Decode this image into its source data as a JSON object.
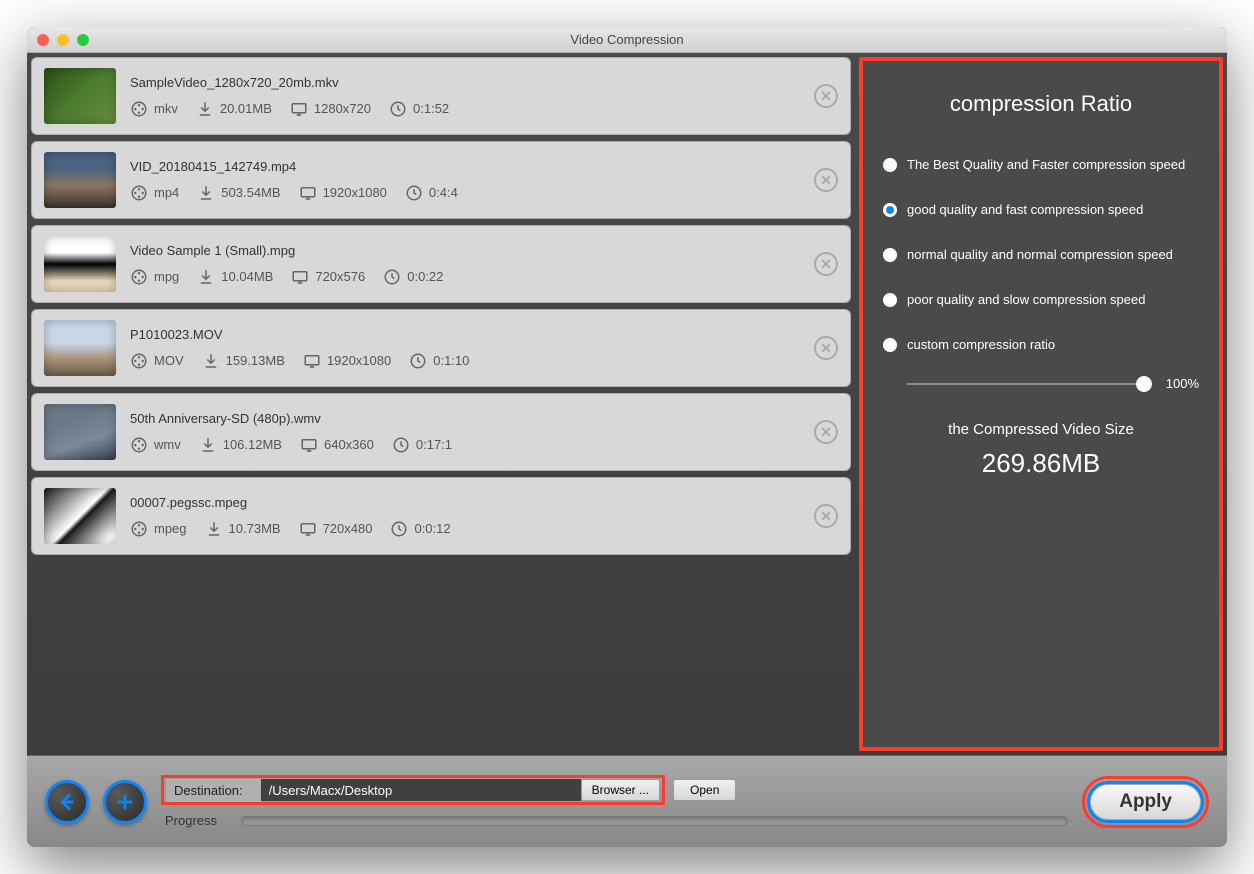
{
  "window": {
    "title": "Video Compression"
  },
  "files": [
    {
      "name": "SampleVideo_1280x720_20mb.mkv",
      "format": "mkv",
      "size": "20.01MB",
      "resolution": "1280x720",
      "duration": "0:1:52"
    },
    {
      "name": "VID_20180415_142749.mp4",
      "format": "mp4",
      "size": "503.54MB",
      "resolution": "1920x1080",
      "duration": "0:4:4"
    },
    {
      "name": "Video Sample 1 (Small).mpg",
      "format": "mpg",
      "size": "10.04MB",
      "resolution": "720x576",
      "duration": "0:0:22"
    },
    {
      "name": "P1010023.MOV",
      "format": "MOV",
      "size": "159.13MB",
      "resolution": "1920x1080",
      "duration": "0:1:10"
    },
    {
      "name": "50th Anniversary-SD (480p).wmv",
      "format": "wmv",
      "size": "106.12MB",
      "resolution": "640x360",
      "duration": "0:17:1"
    },
    {
      "name": "00007.pegssc.mpeg",
      "format": "mpeg",
      "size": "10.73MB",
      "resolution": "720x480",
      "duration": "0:0:12"
    }
  ],
  "sidebar": {
    "title": "compression Ratio",
    "options": [
      {
        "label": "The Best Quality and Faster compression speed",
        "checked": false
      },
      {
        "label": "good quality and fast compression speed",
        "checked": true
      },
      {
        "label": "normal quality and normal compression speed",
        "checked": false
      },
      {
        "label": "poor quality and slow compression speed",
        "checked": false
      },
      {
        "label": "custom compression ratio",
        "checked": false
      }
    ],
    "slider_value": "100%",
    "size_label": "the Compressed Video Size",
    "size_value": "269.86MB"
  },
  "footer": {
    "destination_label": "Destination:",
    "destination_value": "/Users/Macx/Desktop",
    "browser_label": "Browser ...",
    "open_label": "Open",
    "progress_label": "Progress",
    "apply_label": "Apply"
  }
}
